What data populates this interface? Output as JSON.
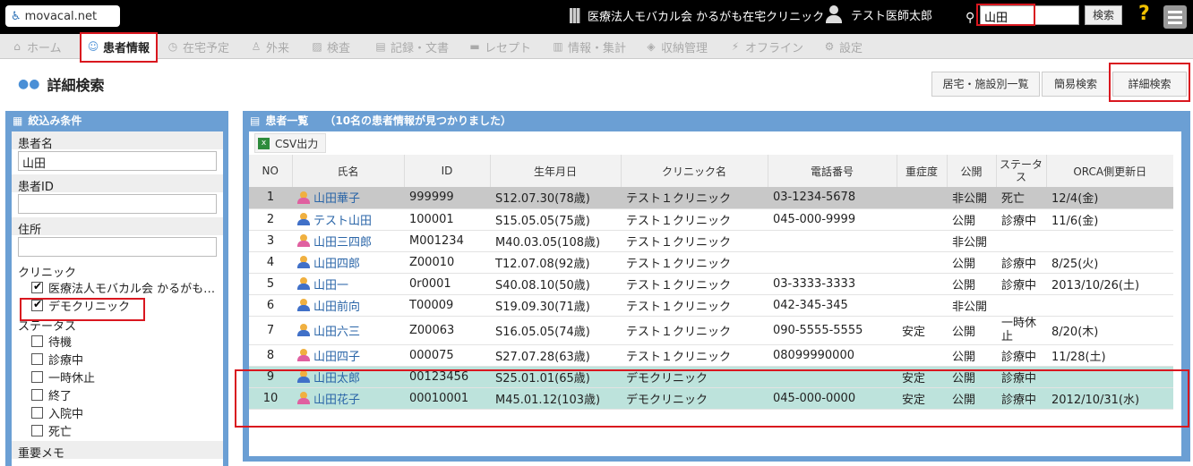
{
  "header": {
    "logo": "movacal.net",
    "clinic_name": "医療法人モバカル会 かるがも在宅クリニック",
    "user_name": "テスト医師太郎",
    "search_value": "山田",
    "search_button": "検索",
    "help": "?"
  },
  "nav": [
    {
      "label": "ホーム",
      "icon": "home-icon"
    },
    {
      "label": "患者情報",
      "icon": "patients-icon"
    },
    {
      "label": "在宅予定",
      "icon": "clock-icon"
    },
    {
      "label": "外来",
      "icon": "outpatient-icon"
    },
    {
      "label": "検査",
      "icon": "chart-icon"
    },
    {
      "label": "記録・文書",
      "icon": "document-icon"
    },
    {
      "label": "レセプト",
      "icon": "receipt-icon"
    },
    {
      "label": "情報・集計",
      "icon": "stats-icon"
    },
    {
      "label": "収納管理",
      "icon": "money-icon"
    },
    {
      "label": "オフライン",
      "icon": "offline-icon"
    },
    {
      "label": "設定",
      "icon": "gear-icon"
    }
  ],
  "page": {
    "title": "詳細検索",
    "buttons": [
      "居宅・施設別一覧",
      "簡易検索",
      "詳細検索"
    ]
  },
  "filter": {
    "title": "絞込み条件",
    "patient_name_label": "患者名",
    "patient_name_value": "山田",
    "patient_id_label": "患者ID",
    "address_label": "住所",
    "clinic_label": "クリニック",
    "clinics": [
      {
        "label": "医療法人モバカル会 かるがも…",
        "checked": true
      },
      {
        "label": "デモクリニック",
        "checked": true
      }
    ],
    "status_label": "ステータス",
    "statuses": [
      "待機",
      "診療中",
      "一時休止",
      "終了",
      "入院中",
      "死亡"
    ],
    "memo_label": "重要メモ"
  },
  "list": {
    "title": "患者一覧",
    "count_text": "（10名の患者情報が見つかりました）",
    "csv_button": "CSV出力",
    "columns": [
      "NO",
      "氏名",
      "ID",
      "生年月日",
      "クリニック名",
      "電話番号",
      "重症度",
      "公開",
      "ステータス",
      "ORCA側更新日"
    ],
    "rows": [
      {
        "no": "1",
        "name": "山田華子",
        "id": "999999",
        "dob": "S12.07.30(78歳)",
        "clinic": "テスト１クリニック",
        "phone": "03-1234-5678",
        "severity": "",
        "public": "非公開",
        "status": "死亡",
        "orca": "12/4(金)"
      },
      {
        "no": "2",
        "name": "テスト山田",
        "id": "100001",
        "dob": "S15.05.05(75歳)",
        "clinic": "テスト１クリニック",
        "phone": "045-000-9999",
        "severity": "",
        "public": "公開",
        "status": "診療中",
        "orca": "11/6(金)"
      },
      {
        "no": "3",
        "name": "山田三四郎",
        "id": "M001234",
        "dob": "M40.03.05(108歳)",
        "clinic": "テスト１クリニック",
        "phone": "",
        "severity": "",
        "public": "非公開",
        "status": "",
        "orca": ""
      },
      {
        "no": "4",
        "name": "山田四郎",
        "id": "Z00010",
        "dob": "T12.07.08(92歳)",
        "clinic": "テスト１クリニック",
        "phone": "",
        "severity": "",
        "public": "公開",
        "status": "診療中",
        "orca": "8/25(火)"
      },
      {
        "no": "5",
        "name": "山田一",
        "id": "0r0001",
        "dob": "S40.08.10(50歳)",
        "clinic": "テスト１クリニック",
        "phone": "03-3333-3333",
        "severity": "",
        "public": "公開",
        "status": "診療中",
        "orca": "2013/10/26(土)"
      },
      {
        "no": "6",
        "name": "山田前向",
        "id": "T00009",
        "dob": "S19.09.30(71歳)",
        "clinic": "テスト１クリニック",
        "phone": "042-345-345",
        "severity": "",
        "public": "非公開",
        "status": "",
        "orca": ""
      },
      {
        "no": "7",
        "name": "山田六三",
        "id": "Z00063",
        "dob": "S16.05.05(74歳)",
        "clinic": "テスト１クリニック",
        "phone": "090-5555-5555",
        "severity": "安定",
        "public": "公開",
        "status": "一時休止",
        "orca": "8/20(木)"
      },
      {
        "no": "8",
        "name": "山田四子",
        "id": "000075",
        "dob": "S27.07.28(63歳)",
        "clinic": "テスト１クリニック",
        "phone": "08099990000",
        "severity": "",
        "public": "公開",
        "status": "診療中",
        "orca": "11/28(土)"
      },
      {
        "no": "9",
        "name": "山田太郎",
        "id": "00123456",
        "dob": "S25.01.01(65歳)",
        "clinic": "デモクリニック",
        "phone": "",
        "severity": "安定",
        "public": "公開",
        "status": "診療中",
        "orca": ""
      },
      {
        "no": "10",
        "name": "山田花子",
        "id": "00010001",
        "dob": "M45.01.12(103歳)",
        "clinic": "デモクリニック",
        "phone": "045-000-0000",
        "severity": "安定",
        "public": "公開",
        "status": "診療中",
        "orca": "2012/10/31(水)"
      }
    ]
  }
}
